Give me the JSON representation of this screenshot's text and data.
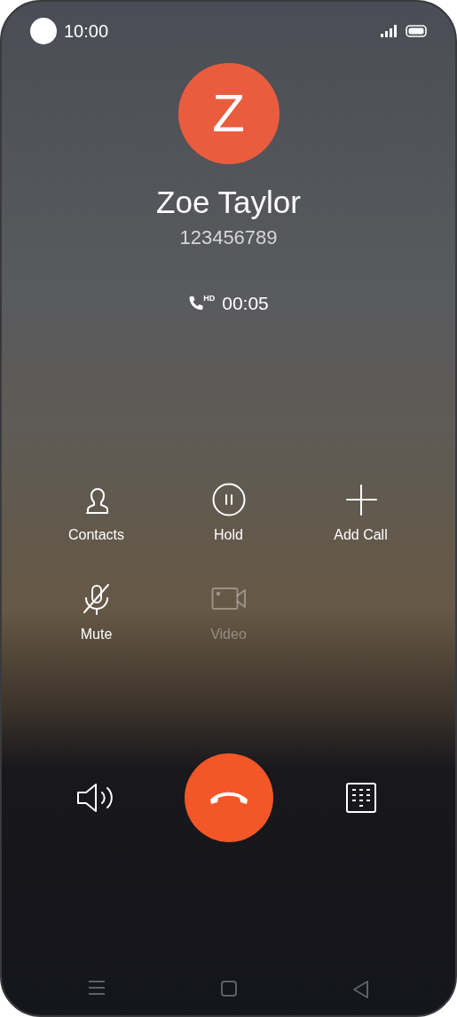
{
  "status_bar": {
    "time": "10:00"
  },
  "caller": {
    "initial": "Z",
    "name": "Zoe Taylor",
    "number": "123456789",
    "duration": "00:05",
    "quality": "HD"
  },
  "actions": [
    {
      "kind": "contacts",
      "label": "Contacts",
      "disabled": false
    },
    {
      "kind": "hold",
      "label": "Hold",
      "disabled": false
    },
    {
      "kind": "add",
      "label": "Add Call",
      "disabled": false
    },
    {
      "kind": "mute",
      "label": "Mute",
      "disabled": false
    },
    {
      "kind": "video",
      "label": "Video",
      "disabled": true
    }
  ]
}
